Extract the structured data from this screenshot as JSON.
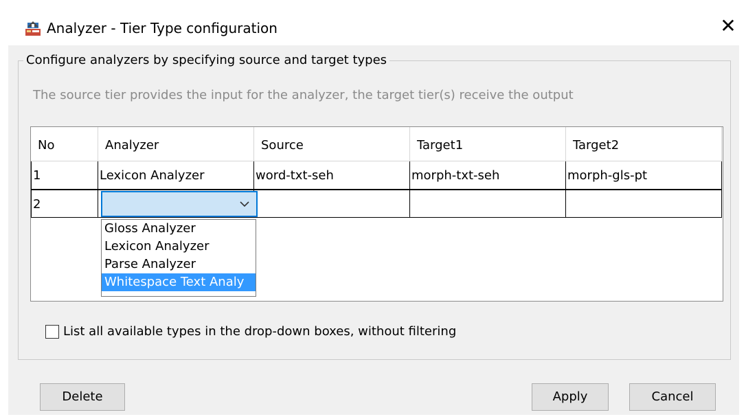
{
  "window": {
    "title": "Analyzer - Tier Type configuration",
    "icon": "analyzer-app-icon",
    "close_icon": "close-icon",
    "close_glyph": "✕"
  },
  "group": {
    "title": "Configure analyzers by specifying source and target types",
    "description": "The source tier provides the input for the analyzer, the target tier(s) receive the output"
  },
  "table": {
    "columns": [
      "No",
      "Analyzer",
      "Source",
      "Target1",
      "Target2"
    ],
    "rows": [
      [
        "1",
        "Lexicon Analyzer",
        "word-txt-seh",
        "morph-txt-seh",
        "morph-gls-pt"
      ],
      [
        "2",
        "",
        "",
        "",
        ""
      ]
    ]
  },
  "analyzer_combo": {
    "value": "",
    "options": [
      "Gloss Analyzer",
      "Lexicon Analyzer",
      "Parse Analyzer",
      "Whitespace Text Analy"
    ],
    "highlighted": "Whitespace Text Analy"
  },
  "filter_checkbox": {
    "label": "List all available types in the drop-down boxes, without filtering",
    "checked": false
  },
  "buttons": {
    "delete": "Delete",
    "apply": "Apply",
    "cancel": "Cancel"
  },
  "colors": {
    "selection": "#3399ff",
    "combo_focus": "#0078d7",
    "combo_fill": "#cce4f7",
    "dialog_bg": "#f0f0f0"
  }
}
